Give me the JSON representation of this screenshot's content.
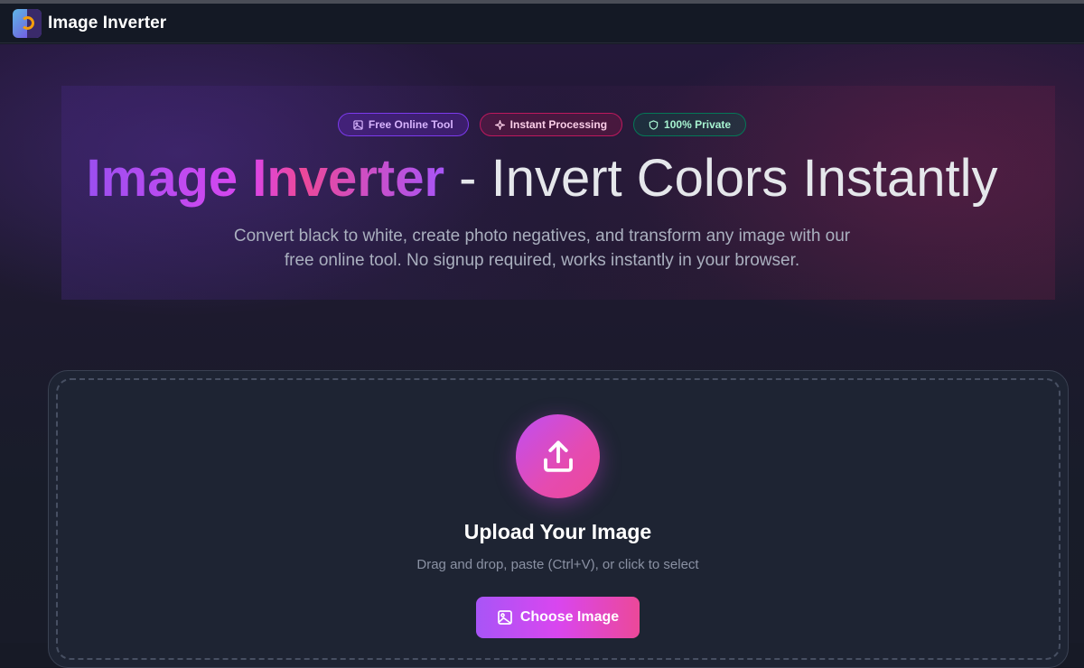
{
  "app": {
    "name": "Image Inverter"
  },
  "badges": [
    {
      "label": "Free Online Tool",
      "icon": "image-icon",
      "color": "#7c3aed"
    },
    {
      "label": "Instant Processing",
      "icon": "sparkle-icon",
      "color": "#be185d"
    },
    {
      "label": "100% Private",
      "icon": "shield-icon",
      "color": "#047857"
    }
  ],
  "hero": {
    "title_highlight": "Image Inverter",
    "title_rest": " - Invert Colors Instantly",
    "subtitle": "Convert black to white, create photo negatives, and transform any image with our free online tool. No signup required, works instantly in your browser."
  },
  "upload": {
    "icon": "upload-icon",
    "title": "Upload Your Image",
    "hint": "Drag and drop, paste (Ctrl+V), or click to select",
    "button_label": "Choose Image",
    "button_icon": "image-icon"
  },
  "colors": {
    "accent_purple": "#a855f7",
    "accent_pink": "#ec4899",
    "background": "#171a26"
  }
}
